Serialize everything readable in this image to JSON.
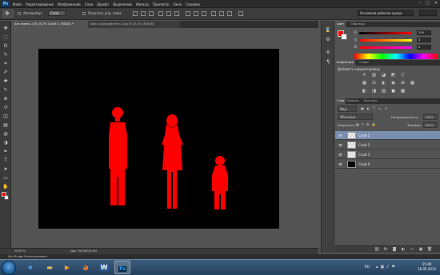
{
  "app": {
    "logo": "Ps",
    "menu": [
      "Файл",
      "Редактирование",
      "Изображение",
      "Слои",
      "Шрифт",
      "Выделение",
      "Фильтр",
      "Просмотр",
      "Окно",
      "Справка"
    ],
    "window_controls": [
      "–",
      "□",
      "✕"
    ]
  },
  "options": {
    "autoselect_label": "Автовыбор:",
    "autoselect_value": "Слой",
    "show_controls_label": "Показать упр. элем.",
    "workspace": "Основная рабочая среда"
  },
  "tools": {
    "icons": [
      "move-icon",
      "marquee-icon",
      "lasso-icon",
      "quick-select-icon",
      "crop-icon",
      "eyedropper-icon",
      "healing-icon",
      "brush-icon",
      "stamp-icon",
      "history-brush-icon",
      "eraser-icon",
      "gradient-icon",
      "blur-icon",
      "dodge-icon",
      "pen-icon",
      "type-icon",
      "path-select-icon",
      "shape-icon",
      "hand-icon",
      "zoom-icon"
    ],
    "glyphs": [
      "✥",
      "⬚",
      "ʘ",
      "✎",
      "⌗",
      "✐",
      "✚",
      "✎",
      "⊕",
      "↺",
      "◫",
      "▤",
      "◍",
      "◑",
      "✒",
      "T",
      "➤",
      "▭",
      "✋",
      "⌕"
    ],
    "foreground_color": "#ff0000",
    "background_color": "#ffffff"
  },
  "document": {
    "tabs": [
      {
        "label": "Без имени-1 @ 16,7% (Слой 1, RGB/8) *"
      },
      {
        "label": "kosh-na-skopljechen-1.jpg @ 25,3% (RGB/8)"
      }
    ],
    "canvas_color": "#000000",
    "figure_color": "#ff0000"
  },
  "status": {
    "zoom": "16,67%",
    "doc_size": "Док: 90,9M/14,0M",
    "bottom_label": "Mini Bridge  Шкала времени"
  },
  "color_panel": {
    "tabs": [
      "Цвет",
      "Образцы"
    ],
    "sliders": [
      {
        "label": "R",
        "value": "255",
        "color_from": "#000000",
        "color_to": "#ff0000"
      },
      {
        "label": "G",
        "value": "0",
        "color_from": "#ff0000",
        "color_to": "#ffff00"
      },
      {
        "label": "B",
        "value": "0",
        "color_from": "#ff0000",
        "color_to": "#ff00ff"
      }
    ]
  },
  "adjustments_panel": {
    "tabs": [
      "Коррекция",
      "Стили"
    ],
    "title": "Добавить корректировку",
    "row1": [
      "☀",
      "▥",
      "◪",
      "◩",
      "▽"
    ],
    "row2": [
      "▦",
      "⚖",
      "◐",
      "◉",
      "⊞",
      "▦"
    ],
    "row3": [
      "◧",
      "◨",
      "▨",
      "◼",
      "▩"
    ]
  },
  "layers_panel": {
    "tabs": [
      "Слои",
      "Каналы",
      "Контуры"
    ],
    "filter_label": "Вид",
    "blend_mode": "Обычные",
    "opacity_label": "Непрозрачность:",
    "opacity_value": "100%",
    "lock_label": "Закрепить:",
    "fill_label": "Заливка:",
    "fill_value": "100%",
    "layers": [
      {
        "name": "Слой 1",
        "selected": true,
        "thumb": "checker"
      },
      {
        "name": "Слой 2",
        "selected": false,
        "thumb": "checker"
      },
      {
        "name": "Слой 3",
        "selected": false,
        "thumb": "checker"
      },
      {
        "name": "Слой 0",
        "selected": false,
        "thumb": "black"
      }
    ],
    "footer_icons": [
      "⛓",
      "fx",
      "◙",
      "◐",
      "▭",
      "▣",
      "🗑"
    ]
  },
  "taskbar": {
    "apps": [
      {
        "name": "ie-icon",
        "glyph": "e",
        "color": "#3fa5ff"
      },
      {
        "name": "explorer-icon",
        "glyph": "▬",
        "color": "#e8c25a"
      },
      {
        "name": "media-player-icon",
        "glyph": "▶",
        "color": "#ff9b2f"
      },
      {
        "name": "firefox-icon",
        "glyph": "◕",
        "color": "#ff7a1e"
      },
      {
        "name": "word-icon",
        "glyph": "W",
        "color": "#2b579a"
      },
      {
        "name": "photoshop-icon",
        "glyph": "Ps",
        "color": "#31a8ff"
      }
    ],
    "tray_lang": "RU",
    "time": "15:49",
    "date": "16.05.2013"
  }
}
